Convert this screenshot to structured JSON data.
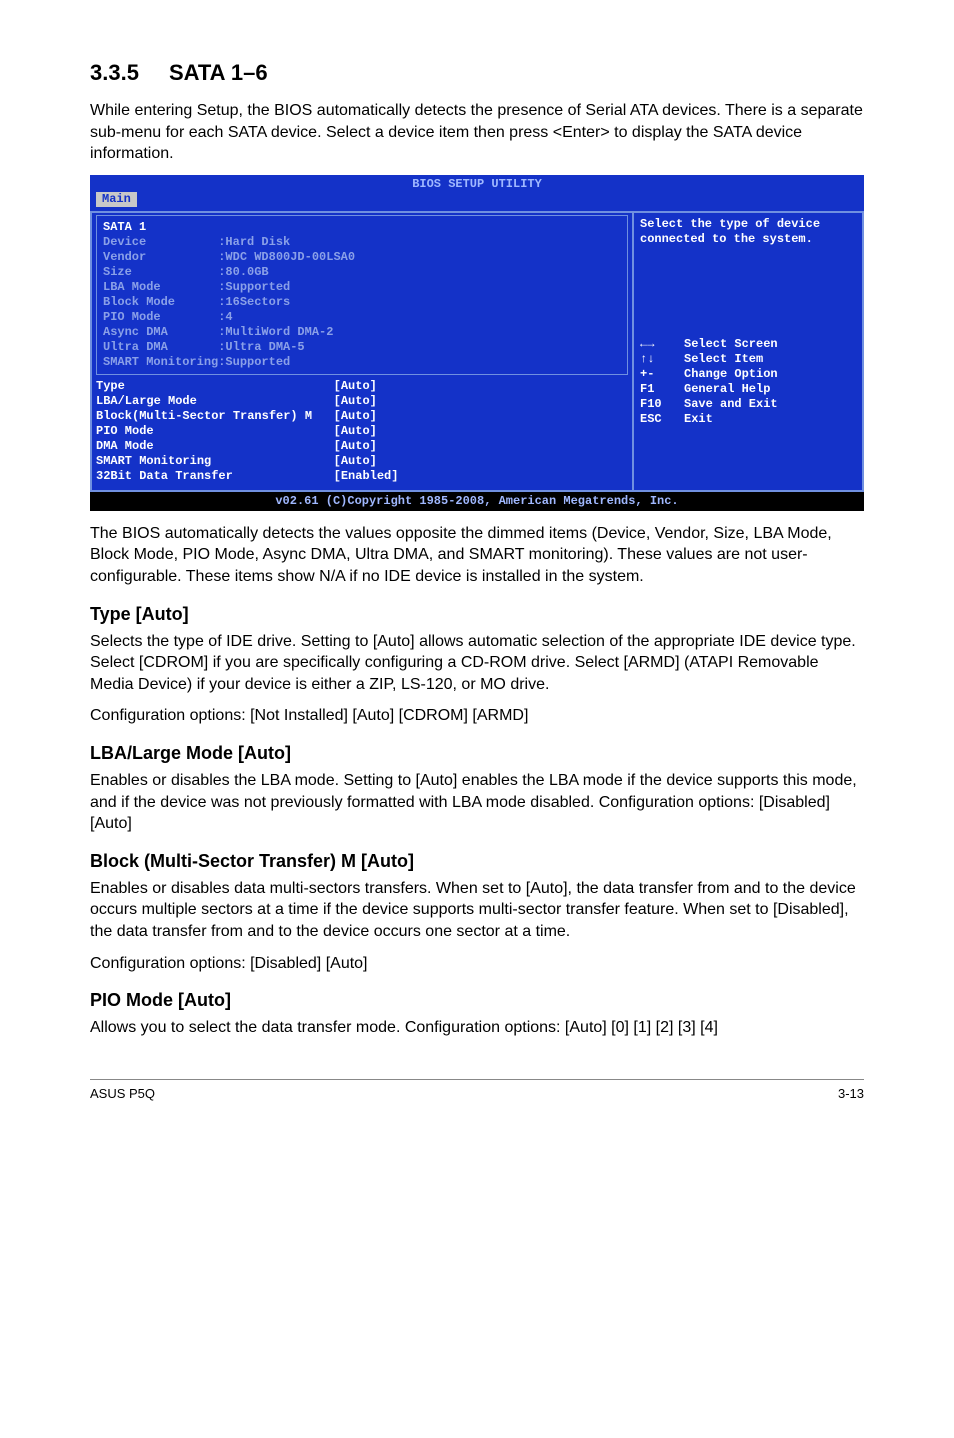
{
  "section": {
    "num": "3.3.5",
    "title": "SATA 1–6"
  },
  "intro": "While entering Setup, the BIOS automatically detects the presence of Serial ATA devices. There is a separate sub-menu for each SATA device. Select a device item then press <Enter> to display the SATA device information.",
  "bios": {
    "title": "BIOS SETUP UTILITY",
    "tab": "Main",
    "sata_label": "SATA 1",
    "info": [
      {
        "k": "Device",
        "v": ":Hard Disk"
      },
      {
        "k": "Vendor",
        "v": ":WDC WD800JD-00LSA0"
      },
      {
        "k": "Size",
        "v": ":80.0GB"
      },
      {
        "k": "LBA Mode",
        "v": ":Supported"
      },
      {
        "k": "Block Mode",
        "v": ":16Sectors"
      },
      {
        "k": "PIO Mode",
        "v": ":4"
      },
      {
        "k": "Async DMA",
        "v": ":MultiWord DMA-2"
      },
      {
        "k": "Ultra DMA",
        "v": ":Ultra DMA-5"
      },
      {
        "k": "SMART Monitoring",
        "v": ":Supported"
      }
    ],
    "settings": [
      {
        "k": "Type",
        "v": "[Auto]"
      },
      {
        "k": "LBA/Large Mode",
        "v": "[Auto]"
      },
      {
        "k": "Block(Multi-Sector Transfer) M",
        "v": "[Auto]"
      },
      {
        "k": "PIO Mode",
        "v": "[Auto]"
      },
      {
        "k": "DMA Mode",
        "v": "[Auto]"
      },
      {
        "k": "SMART Monitoring",
        "v": "[Auto]"
      },
      {
        "k": "32Bit Data Transfer",
        "v": "[Enabled]"
      }
    ],
    "help": "Select the type of device connected to the system.",
    "legend": [
      {
        "key": "←→",
        "txt": "Select Screen"
      },
      {
        "key": "↑↓",
        "txt": "Select Item"
      },
      {
        "key": "+-",
        "txt": "Change Option"
      },
      {
        "key": "F1",
        "txt": "General Help"
      },
      {
        "key": "F10",
        "txt": "Save and Exit"
      },
      {
        "key": "ESC",
        "txt": "Exit"
      }
    ],
    "footer": "v02.61 (C)Copyright 1985-2008, American Megatrends, Inc."
  },
  "after_bios": "The BIOS automatically detects the values opposite the dimmed items (Device, Vendor, Size, LBA Mode, Block Mode, PIO Mode, Async DMA, Ultra DMA, and SMART monitoring). These values are not user-configurable. These items show N/A if no IDE device is installed in the system.",
  "type": {
    "h": "Type [Auto]",
    "p1": "Selects the type of IDE drive. Setting to [Auto] allows automatic selection of the appropriate IDE device type. Select [CDROM] if you are specifically configuring a CD-ROM drive. Select [ARMD] (ATAPI Removable Media Device) if your device is either a ZIP, LS-120, or MO drive.",
    "p2": "Configuration options: [Not Installed] [Auto] [CDROM] [ARMD]"
  },
  "lba": {
    "h": "LBA/Large Mode [Auto]",
    "p": "Enables or disables the LBA mode. Setting to [Auto] enables the LBA mode if the device supports this mode, and if the device was not previously formatted with LBA mode disabled. Configuration options: [Disabled] [Auto]"
  },
  "block": {
    "h": "Block (Multi-Sector Transfer) M [Auto]",
    "p1": "Enables or disables data multi-sectors transfers. When set to [Auto], the data transfer from and to the device occurs multiple sectors at a time if the device supports multi-sector transfer feature. When set to [Disabled], the data transfer from and to the device occurs one sector at a time.",
    "p2": "Configuration options: [Disabled] [Auto]"
  },
  "pio": {
    "h": "PIO Mode [Auto]",
    "p": "Allows you to select the data transfer mode. Configuration options: [Auto] [0] [1] [2] [3] [4]"
  },
  "footer": {
    "left": "ASUS P5Q",
    "right": "3-13"
  }
}
